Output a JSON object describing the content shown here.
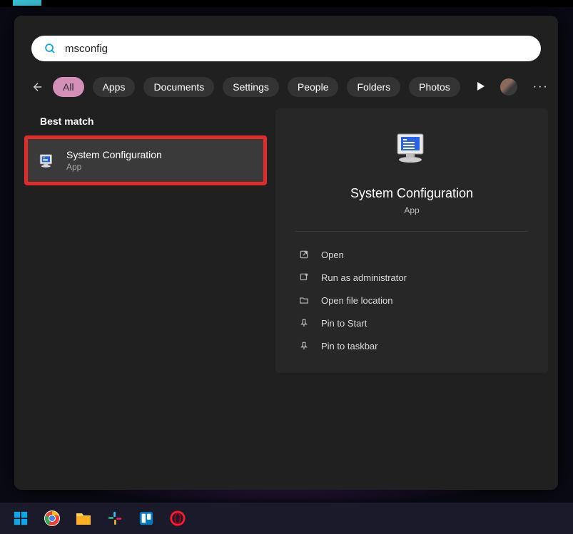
{
  "search": {
    "value": "msconfig",
    "placeholder": ""
  },
  "filters": {
    "items": [
      "All",
      "Apps",
      "Documents",
      "Settings",
      "People",
      "Folders",
      "Photos"
    ],
    "active_index": 0
  },
  "best_match": {
    "header": "Best match",
    "result_title": "System Configuration",
    "result_sub": "App"
  },
  "details": {
    "title": "System Configuration",
    "sub": "App",
    "actions": [
      {
        "icon": "open",
        "label": "Open"
      },
      {
        "icon": "admin",
        "label": "Run as administrator"
      },
      {
        "icon": "folder",
        "label": "Open file location"
      },
      {
        "icon": "pin",
        "label": "Pin to Start"
      },
      {
        "icon": "pin",
        "label": "Pin to taskbar"
      }
    ]
  },
  "taskbar": {
    "items": [
      "start",
      "chrome",
      "explorer",
      "slack",
      "trello",
      "opera"
    ]
  }
}
